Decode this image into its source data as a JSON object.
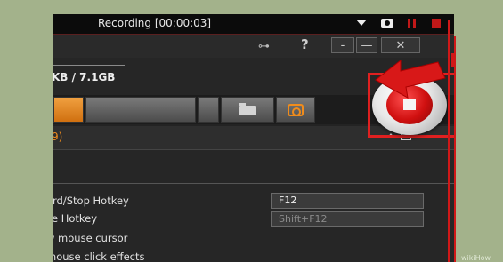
{
  "recording_bar": {
    "title": "Recording [00:00:03]"
  },
  "header": {
    "partial_text": ")",
    "help": "?",
    "buttons": [
      "-",
      "—",
      "✕"
    ]
  },
  "storage": {
    "text": "KB / 7.1GB"
  },
  "section": {
    "partial_text": "9)"
  },
  "settings": {
    "record_stop_hotkey_label": "ord/Stop Hotkey",
    "record_stop_hotkey_value": "F12",
    "pause_hotkey_label": "se Hotkey",
    "pause_hotkey_value": "Shift+F12",
    "show_cursor_label": "w mouse cursor",
    "click_effects_label": "mouse click effects"
  },
  "watermark": "wikiHow",
  "colors": {
    "accent_red": "#d01818",
    "accent_orange": "#f08c1c",
    "bg_green": "#a3b28b"
  }
}
